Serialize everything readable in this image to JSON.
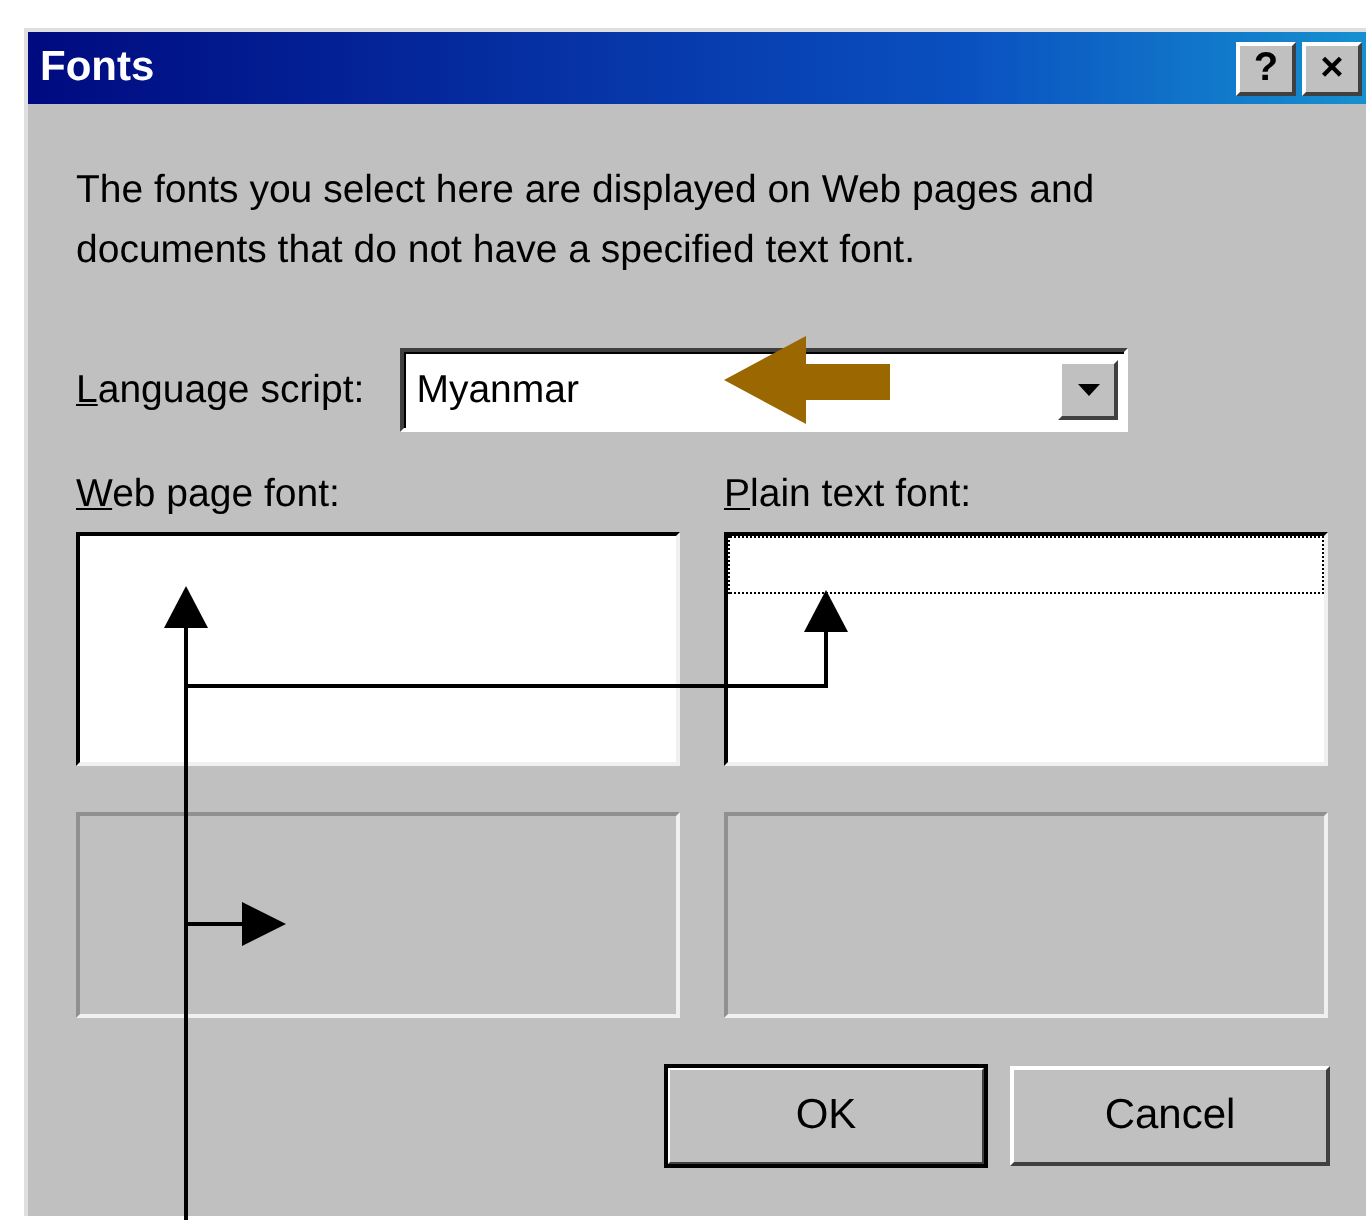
{
  "window": {
    "title": "Fonts",
    "buttons": [
      "?",
      "×"
    ]
  },
  "description": "The fonts you select here are displayed on Web pages and documents that do not have a specified text font.",
  "language_script": {
    "label": "Language script:",
    "value": "Myanmar"
  },
  "font_lists": [
    {
      "label": "Web page font:",
      "focused": false
    },
    {
      "label": "Plain text font:",
      "focused": true
    }
  ],
  "buttons": [
    {
      "label": "OK",
      "default": true
    },
    {
      "label": "Cancel",
      "default": false
    }
  ]
}
